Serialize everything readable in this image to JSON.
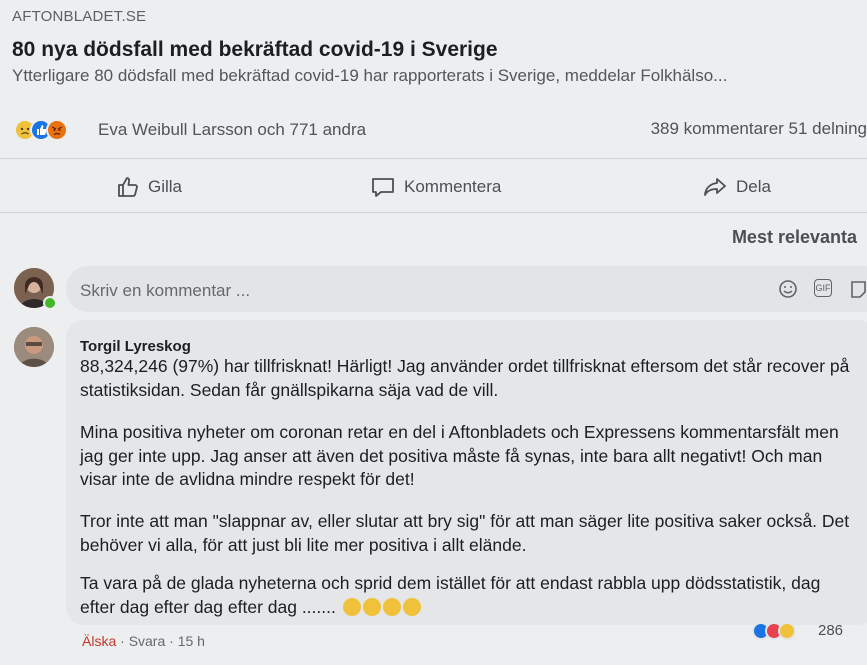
{
  "link": {
    "source": "AFTONBLADET.SE",
    "title": "80 nya dödsfall med bekräftad covid-19 i Sverige",
    "description": "Ytterligare 80 dödsfall med bekräftad covid-19 har rapporterats i Sverige, meddelar Folkhälso..."
  },
  "reactions": {
    "icons": [
      "sad-icon",
      "like-icon",
      "angry-icon"
    ],
    "summary": "Eva Weibull Larsson och 771 andra",
    "stats": "389 kommentarer  51 delning"
  },
  "actions": {
    "like": "Gilla",
    "comment": "Kommentera",
    "share": "Dela"
  },
  "sort_label": "Mest relevanta",
  "composer": {
    "placeholder": "Skriv en kommentar ...",
    "gif_label": "GIF"
  },
  "comment": {
    "author": "Torgil Lyreskog",
    "paragraphs": [
      "88,324,246 (97%) har tillfrisknat! Härligt! Jag använder ordet tillfrisknat eftersom det står recover på statistiksidan. Sedan får gnällspikarna säja vad de vill.",
      "Mina positiva nyheter om coronan retar en del i Aftonbladets och Expressens kommentarsfält men jag ger inte upp. Jag anser att även det positiva måste få synas, inte bara allt negativt! Och man visar inte de avlidna mindre respekt för det!",
      "Tror inte att man \"slappnar av, eller slutar att bry sig\" för att man säger lite positiva saker också. Det behöver vi alla, för att just bli lite mer positiva i allt elände.",
      "Ta vara på de glada nyheterna och sprid dem istället för att endast rabbla upp dödsstatistik, dag efter dag efter dag efter dag ......."
    ],
    "reaction_count": "286",
    "like_link": "Älska",
    "reply_link": "Svara",
    "time": "15 h"
  },
  "colors": {
    "background": "#eceeef",
    "bubble": "#e4e6e8",
    "accent_blue": "#1b74e4",
    "love_red": "#c0392b",
    "online_green": "#42b72a"
  }
}
